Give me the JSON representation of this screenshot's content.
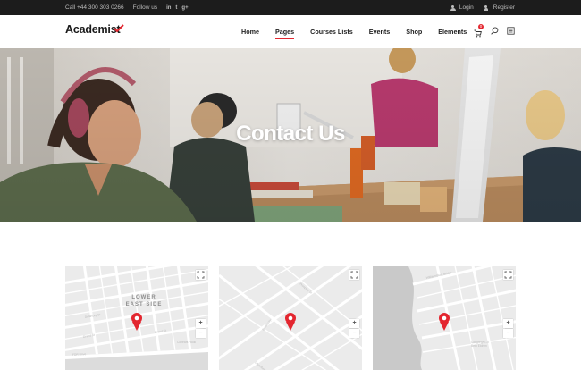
{
  "topbar": {
    "phone": "Call +44 300 303 0266",
    "follow_label": "Follow us",
    "social": [
      "in",
      "t",
      "g+"
    ],
    "login": "Login",
    "register": "Register"
  },
  "header": {
    "logo": "Academist",
    "nav": [
      {
        "label": "Home",
        "active": false
      },
      {
        "label": "Pages",
        "active": true
      },
      {
        "label": "Courses Lists",
        "active": false
      },
      {
        "label": "Events",
        "active": false
      },
      {
        "label": "Shop",
        "active": false
      },
      {
        "label": "Elements",
        "active": false
      }
    ],
    "cart_count": "0",
    "accent_color": "#e3262f"
  },
  "hero": {
    "title": "Contact Us"
  },
  "maps": [
    {
      "district": [
        "LOWER",
        "EAST SIDE"
      ],
      "labels": [
        "Delancey St",
        "Grand St",
        "FDR Drive",
        "Corlears Hook"
      ],
      "zoom_in": "+",
      "zoom_out": "−"
    },
    {
      "labels": [
        "Broadway",
        "Prospect St",
        "Chambers St"
      ],
      "zoom_in": "+",
      "zoom_out": "−"
    },
    {
      "labels": [
        "Williamsburg Bridge",
        "Congregation Beth Elohim"
      ],
      "zoom_in": "+",
      "zoom_out": "−"
    }
  ]
}
